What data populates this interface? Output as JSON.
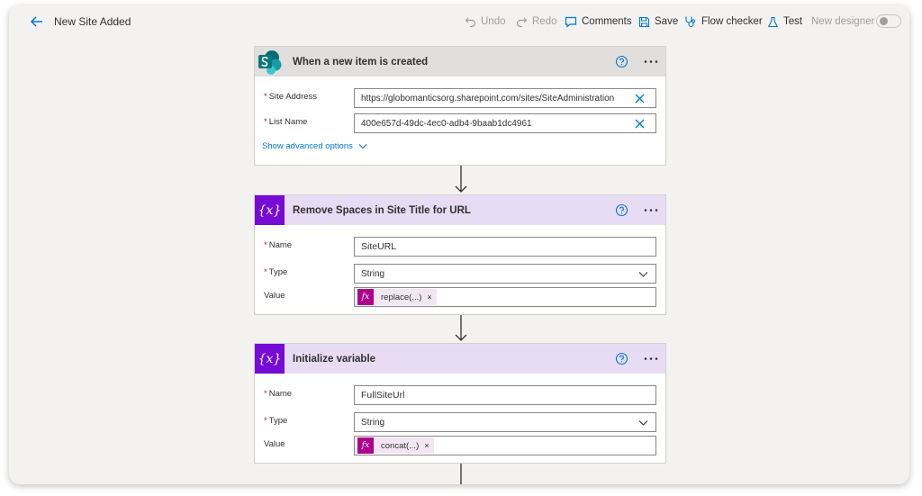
{
  "header": {
    "title": "New Site Added",
    "undo_label": "Undo",
    "redo_label": "Redo",
    "comments_label": "Comments",
    "save_label": "Save",
    "flow_checker_label": "Flow checker",
    "test_label": "Test",
    "new_designer_label": "New designer",
    "new_designer_enabled": false
  },
  "trigger": {
    "title": "When a new item is created",
    "icon": "sharepoint-icon",
    "fields": [
      {
        "label": "Site Address",
        "required": true,
        "value": "https://globomanticsorg.sharepoint.com/sites/SiteAdministration"
      },
      {
        "label": "List Name",
        "required": true,
        "value": "400e657d-49dc-4ec0-adb4-9baab1dc4961"
      }
    ],
    "advanced_label": "Show advanced options"
  },
  "step1": {
    "title": "Remove Spaces in Site Title for URL",
    "icon": "variable-icon",
    "name_label": "Name",
    "name_value": "SiteURL",
    "type_label": "Type",
    "type_value": "String",
    "value_label": "Value",
    "token_label": "replace(...)",
    "token_remove": "×"
  },
  "step2": {
    "title": "Initialize variable",
    "icon": "variable-icon",
    "name_label": "Name",
    "name_value": "FullSiteUrl",
    "type_label": "Type",
    "type_value": "String",
    "value_label": "Value",
    "token_label": "concat(...)",
    "token_remove": "×"
  },
  "required_mark": "*",
  "fx_label": "fx",
  "var_glyph": "{x}",
  "colors": {
    "accent": "#0078d4",
    "variable_purple": "#770bd6",
    "variable_header": "#e8dcf5",
    "expression_magenta": "#ad008c",
    "sharepoint_teal": "#038387"
  }
}
